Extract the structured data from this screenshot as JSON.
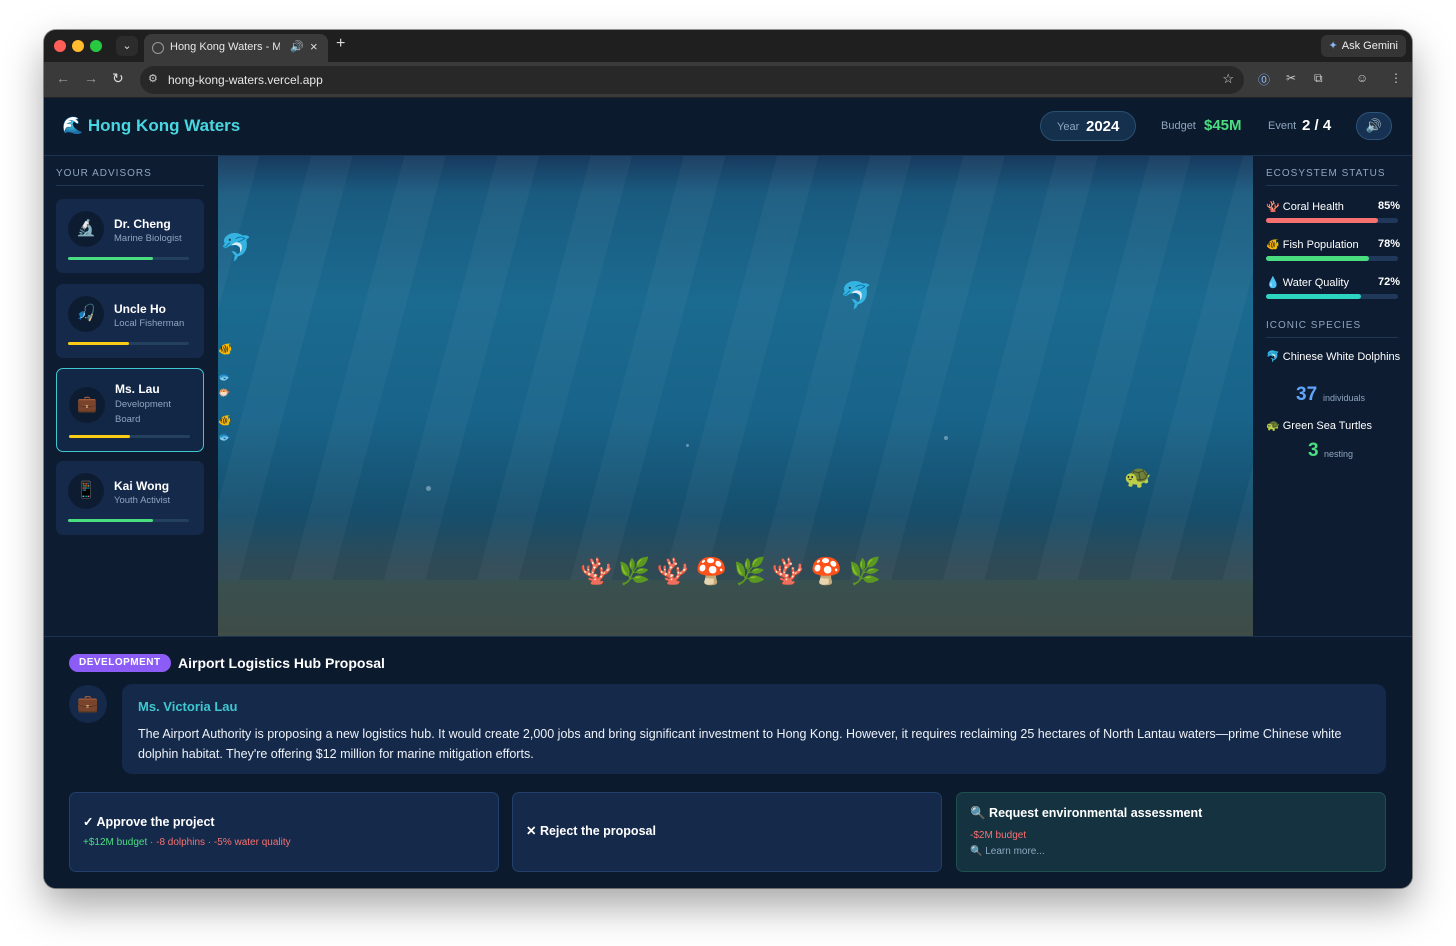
{
  "browser": {
    "tab_title": "Hong Kong Waters - Marine",
    "tab_sound_icon": "🔊",
    "tab_close": "×",
    "new_tab": "+",
    "ask_gemini": "Ask Gemini",
    "url": "hong-kong-waters.vercel.app"
  },
  "header": {
    "brand": "🌊 Hong Kong Waters",
    "year_label": "Year",
    "year_value": "2024",
    "budget_label": "Budget",
    "budget_value": "$45M",
    "event_label": "Event",
    "event_value": "2 / 4",
    "sound_icon": "🔊"
  },
  "advisors": {
    "title": "YOUR ADVISORS",
    "items": [
      {
        "icon": "🔬",
        "name": "Dr. Cheng",
        "role": "Marine Biologist",
        "level": 0.7,
        "color": "#4ade80"
      },
      {
        "icon": "🎣",
        "name": "Uncle Ho",
        "role": "Local Fisherman",
        "level": 0.5,
        "color": "#facc15"
      },
      {
        "icon": "💼",
        "name": "Ms. Lau",
        "role_line1": "Development",
        "role_line2": "Board",
        "level": 0.5,
        "color": "#facc15"
      },
      {
        "icon": "📱",
        "name": "Kai Wong",
        "role": "Youth Activist",
        "level": 0.7,
        "color": "#4ade80"
      }
    ]
  },
  "ocean": {
    "reef": "🪸🌿🪸🍄🌿🪸🍄🌿"
  },
  "ecosystem": {
    "title": "ECOSYSTEM STATUS",
    "metrics": [
      {
        "icon": "🪸",
        "label": "Coral Health",
        "value": "85%",
        "level": 0.85,
        "color": "#f87171"
      },
      {
        "icon": "🐠",
        "label": "Fish Population",
        "value": "78%",
        "level": 0.78,
        "color": "#4ade80"
      },
      {
        "icon": "💧",
        "label": "Water Quality",
        "value": "72%",
        "level": 0.72,
        "color": "#2dd4bf"
      }
    ],
    "species_title": "ICONIC SPECIES",
    "species": [
      {
        "label": "🐬 Chinese White Dolphins",
        "count": "37",
        "unit": "individuals",
        "color": "#60a5fa"
      },
      {
        "label": "🐢 Green Sea Turtles",
        "count": "3",
        "unit": "nesting",
        "color": "#4ade80"
      }
    ]
  },
  "event": {
    "category": "DEVELOPMENT",
    "title": "Airport Logistics Hub Proposal",
    "speaker_icon": "💼",
    "speaker_name": "Ms. Victoria Lau",
    "speech": "The Airport Authority is proposing a new logistics hub. It would create 2,000 jobs and bring significant investment to Hong Kong. However, it requires reclaiming 25 hectares of North Lantau waters—prime Chinese white dolphin habitat. They're offering $12 million for marine mitigation efforts.",
    "choices": [
      {
        "title": "✓ Approve the project",
        "effect_pos": "+$12M budget",
        "sep": " · ",
        "effect_neg1": "-8 dolphins",
        "effect_neg2": "-5% water quality"
      },
      {
        "title": "✕ Reject the proposal"
      },
      {
        "title": "🔍 Request environmental assessment",
        "effect_neg": "-$2M budget",
        "learn": "🔍 Learn more..."
      }
    ]
  },
  "colors": {
    "accent": "#3fc7d0",
    "brand": "#48d7e0",
    "badge": "#8b5cf6",
    "positive": "#4ade80",
    "negative": "#f87171"
  }
}
